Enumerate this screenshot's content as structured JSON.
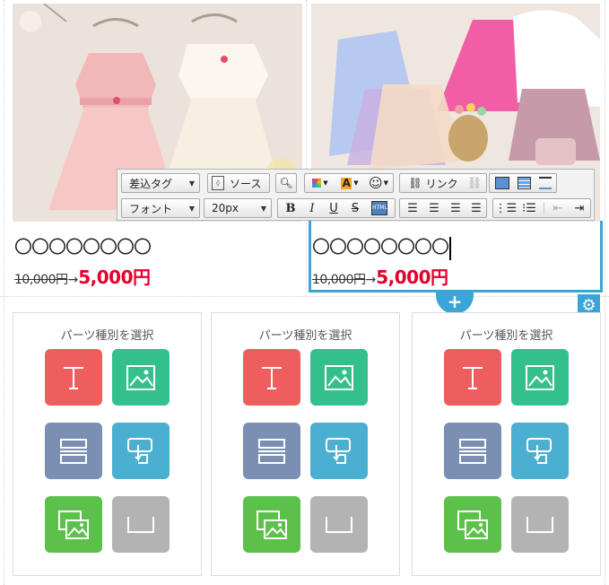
{
  "products": [
    {
      "title": "〇〇〇〇〇〇〇〇",
      "old_price": "10,000円",
      "arrow": "→",
      "new_price": "5,000円"
    },
    {
      "title": "〇〇〇〇〇〇〇〇",
      "old_price": "10,000円",
      "arrow": "→",
      "new_price": "5,000円"
    }
  ],
  "toolbar": {
    "insert_tag": "差込タグ",
    "source": "ソース",
    "link": "リンク",
    "font": "フォント",
    "font_size": "20px"
  },
  "block_actions": {
    "add": "+",
    "settings": "⚙"
  },
  "parts": {
    "label": "パーツ種別を選択",
    "tile_icons": [
      "text-icon",
      "image-icon",
      "divider-icon",
      "button-icon",
      "gallery-icon",
      "spacer-icon"
    ]
  },
  "colors": {
    "accent": "#3aa5d6",
    "sale_price": "#e4002b"
  }
}
